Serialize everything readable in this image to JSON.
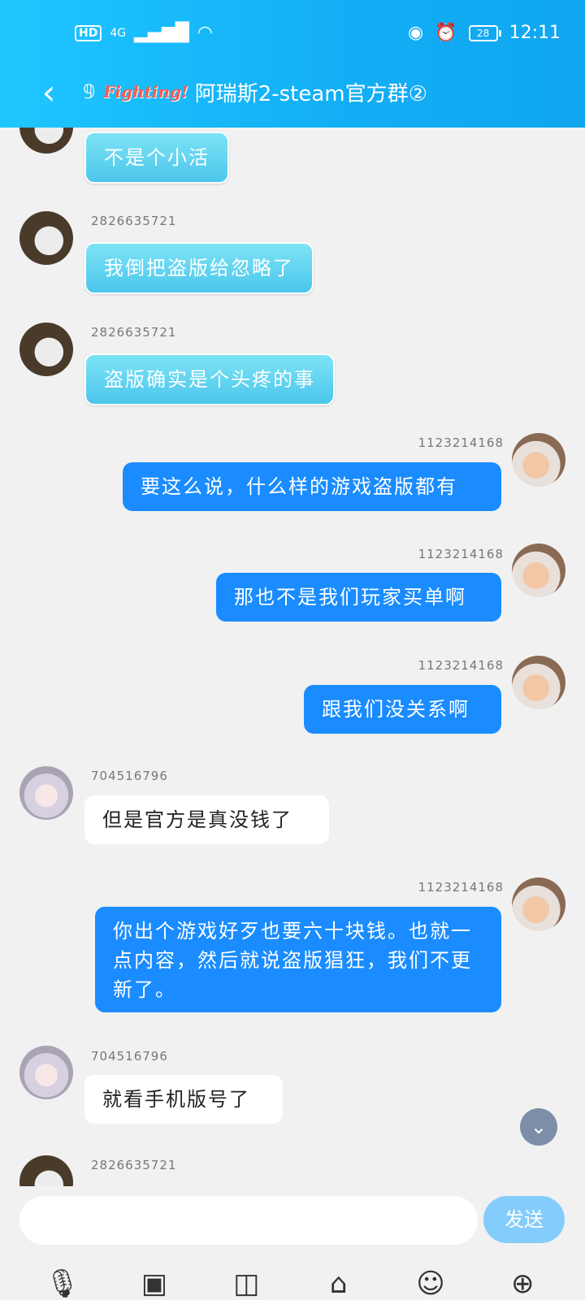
{
  "status_bar": {
    "hd": "HD",
    "network": "4G",
    "battery": "28",
    "time": "12:11"
  },
  "header": {
    "back_icon": "chevron-left-icon",
    "ear_icon": "ear-icon",
    "logo_text": "Fighting!",
    "title": "阿瑞斯2-steam官方群②"
  },
  "messages": [
    {
      "side": "left",
      "sender": "",
      "text": "不是个小活",
      "style": "cyan",
      "avatar": "bear"
    },
    {
      "side": "left",
      "sender": "2826635721",
      "text": "我倒把盗版给忽略了",
      "style": "cyan",
      "avatar": "bear"
    },
    {
      "side": "left",
      "sender": "2826635721",
      "text": "盗版确实是个头疼的事",
      "style": "cyan",
      "avatar": "bear"
    },
    {
      "side": "right",
      "sender": "1123214168",
      "text": "要这么说，什么样的游戏盗版都有",
      "style": "blue",
      "avatar": "face"
    },
    {
      "side": "right",
      "sender": "1123214168",
      "text": "那也不是我们玩家买单啊",
      "style": "blue",
      "avatar": "face"
    },
    {
      "side": "right",
      "sender": "1123214168",
      "text": "跟我们没关系啊",
      "style": "blue",
      "avatar": "face"
    },
    {
      "side": "left",
      "sender": "704516796",
      "text": "但是官方是真没钱了",
      "style": "white",
      "avatar": "girl"
    },
    {
      "side": "right",
      "sender": "1123214168",
      "text": "你出个游戏好歹也要六十块钱。也就一点内容，然后就说盗版猖狂，我们不更新了。",
      "style": "blue",
      "avatar": "face"
    },
    {
      "side": "left",
      "sender": "704516796",
      "text": "就看手机版号了",
      "style": "white",
      "avatar": "girl"
    },
    {
      "side": "left",
      "sender": "2826635721",
      "text": "",
      "style": "cyan",
      "avatar": "bear"
    }
  ],
  "input": {
    "placeholder": "",
    "value": "",
    "send_label": "发送"
  },
  "toolbar": [
    "microphone-icon",
    "image-icon",
    "camera-icon",
    "redpacket-icon",
    "emoji-icon",
    "plus-icon"
  ]
}
